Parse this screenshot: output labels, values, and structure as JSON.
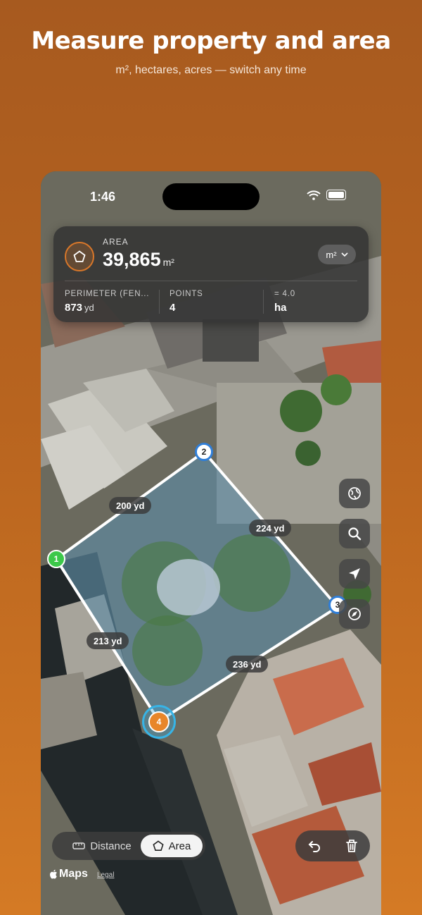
{
  "promo": {
    "headline": "Measure property and area",
    "subline": "m², hectares, acres — switch any time"
  },
  "status_bar": {
    "time": "1:46",
    "icons": [
      "wifi-icon",
      "battery-icon"
    ]
  },
  "measure_card": {
    "area_label": "AREA",
    "area_value": "39,865",
    "area_unit": "m²",
    "unit_selector": "m²",
    "stats": [
      {
        "label": "PERIMETER (FEN...",
        "value": "873",
        "unit": "yd"
      },
      {
        "label": "POINTS",
        "value": "4",
        "unit": ""
      },
      {
        "label": "= 4.0",
        "value": "ha",
        "unit": ""
      }
    ]
  },
  "polygon": {
    "points": [
      {
        "label": "1",
        "color": "#3cc84a"
      },
      {
        "label": "2",
        "color": "#2f7ed8"
      },
      {
        "label": "3",
        "color": "#2f7ed8"
      },
      {
        "label": "4",
        "color": "#e8862a"
      }
    ],
    "edges": [
      "200 yd",
      "224 yd",
      "236 yd",
      "213 yd"
    ]
  },
  "map_controls": [
    "globe-icon",
    "search-icon",
    "location-arrow-icon",
    "compass-icon"
  ],
  "mode_switch": {
    "distance_label": "Distance",
    "area_label": "Area",
    "selected": "Area"
  },
  "actions": [
    "undo-icon",
    "trash-icon"
  ],
  "attribution": {
    "brand": "Maps",
    "legal": "Legal"
  },
  "colors": {
    "background": "#b8641f",
    "accent": "#e8862a",
    "polygon_fill": "#5a8aa8"
  }
}
